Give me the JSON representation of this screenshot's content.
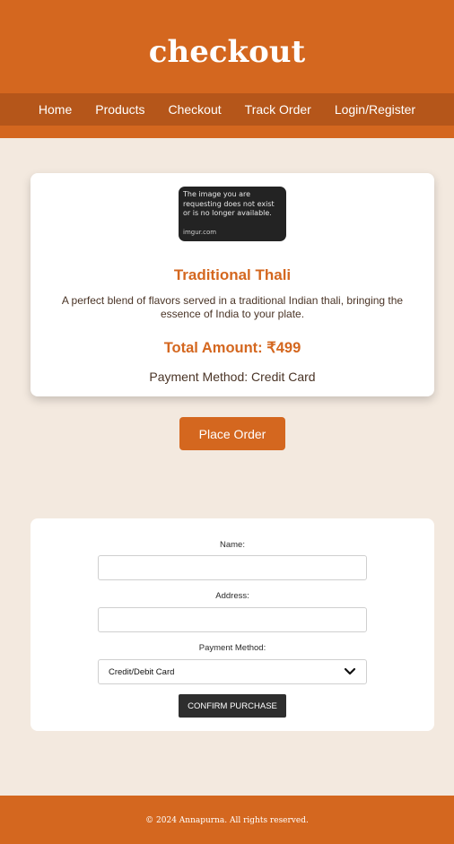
{
  "header": {
    "title": "checkout",
    "nav": [
      "Home",
      "Products",
      "Checkout",
      "Track Order",
      "Login/Register"
    ]
  },
  "order": {
    "image_text": "The image you are requesting does not exist or is no longer available.",
    "image_source": "imgur.com",
    "dish_title": "Traditional Thali",
    "dish_description": "A perfect blend of flavors served in a traditional Indian thali, bringing the essence of India to your plate.",
    "total_amount": "Total Amount: ₹499",
    "payment_method": "Payment Method: Credit Card"
  },
  "place_order_label": "Place Order",
  "form": {
    "name_label": "Name:",
    "name_value": "",
    "address_label": "Address:",
    "address_value": "",
    "payment_label": "Payment Method:",
    "payment_selected": "Credit/Debit Card",
    "confirm_label": "CONFIRM PURCHASE"
  },
  "footer": {
    "copyright": "© 2024 Annapurna. All rights reserved."
  },
  "colors": {
    "accent": "#d4671f",
    "nav_bg": "#b5561a",
    "page_bg": "#f3e9df",
    "button_dark": "#2e2e2e"
  },
  "icons": {
    "select_chevron": "chevron-down-icon"
  }
}
